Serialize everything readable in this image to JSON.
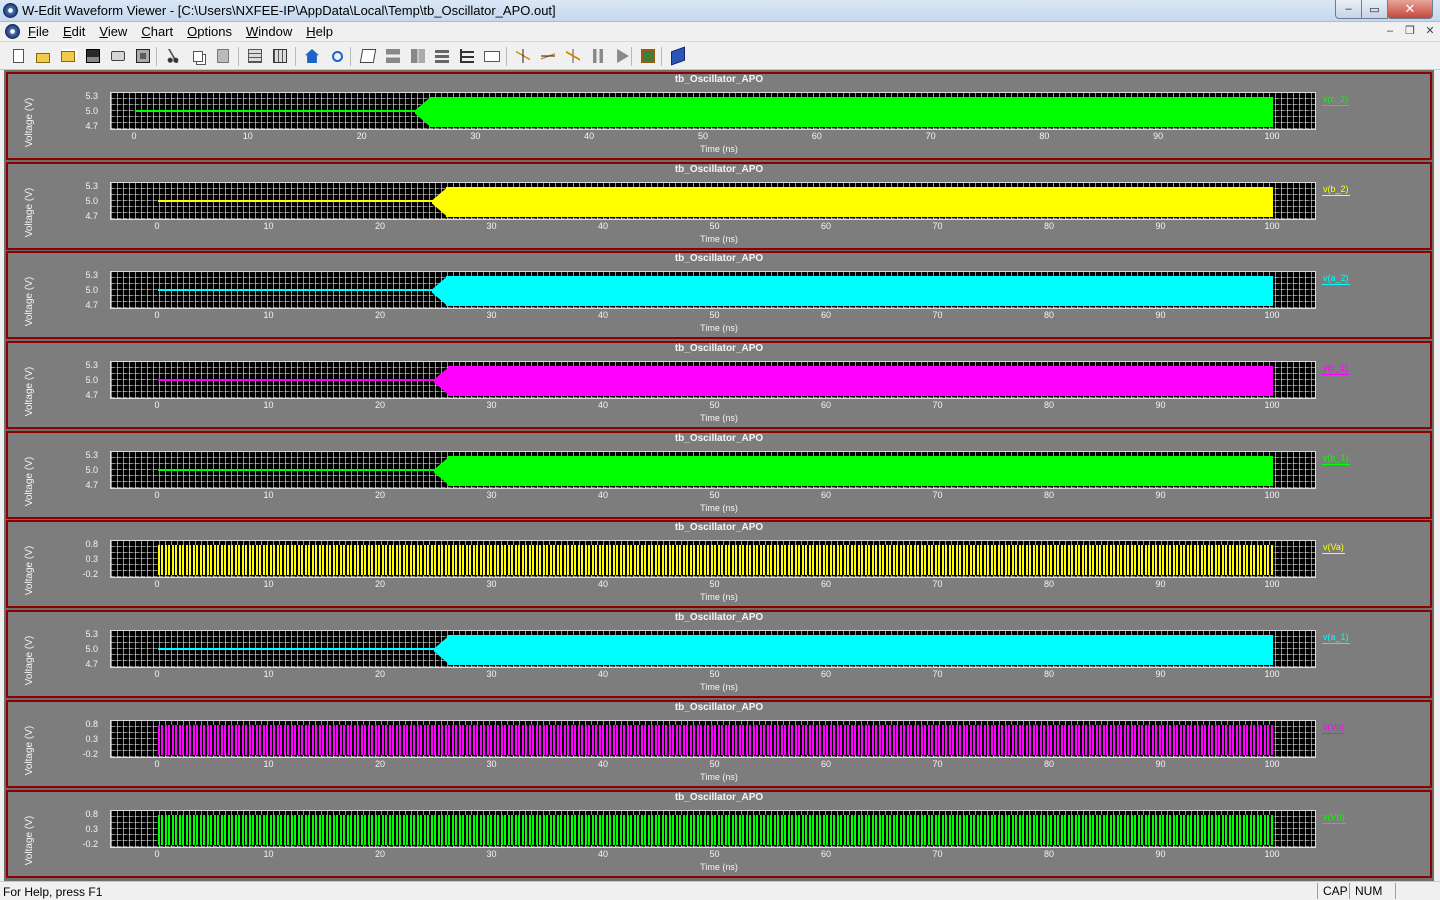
{
  "window": {
    "title": "W-Edit Waveform Viewer - [C:\\Users\\NXFEE-IP\\AppData\\Local\\Temp\\tb_Oscillator_APO.out]",
    "controls": {
      "minimize": "–",
      "maximize": "▭",
      "close": "✕"
    }
  },
  "menu": {
    "items": [
      {
        "ul": "F",
        "rest": "ile"
      },
      {
        "ul": "E",
        "rest": "dit"
      },
      {
        "ul": "V",
        "rest": "iew"
      },
      {
        "ul": "C",
        "rest": "hart"
      },
      {
        "ul": "O",
        "rest": "ptions"
      },
      {
        "ul": "W",
        "rest": "indow"
      },
      {
        "ul": "H",
        "rest": "elp"
      }
    ],
    "mdi": {
      "minimize": "–",
      "restore": "❐",
      "close": "✕"
    }
  },
  "toolbar": {
    "icons": [
      "new-icon",
      "open-icon",
      "open-folder-icon",
      "save-icon",
      "print-icon",
      "export-image-icon",
      "cut-icon",
      "copy-icon",
      "paste-icon",
      "tile-horizontal-icon",
      "tile-vertical-icon",
      "home-icon",
      "zoom-icon",
      "edit-chart-icon",
      "stack-icon",
      "stack-alt-icon",
      "arrange-icon",
      "fit-icon",
      "text-label-icon",
      "vertical-cursor-icon",
      "horizontal-cursor-icon",
      "xy-cursor-icon",
      "pause-icon",
      "play-icon",
      "chart-image-icon",
      "help-book-icon"
    ]
  },
  "charts": {
    "x_axis_label": "Time (ns)",
    "y_axis_label": "Voltage (V)",
    "x_ticks": [
      "0",
      "10",
      "20",
      "30",
      "40",
      "50",
      "60",
      "70",
      "80",
      "90",
      "100"
    ],
    "panels": [
      {
        "title": "tb_Oscillator_APO",
        "legend": "v(c_2)",
        "color": "#00ff00",
        "kind": "onset",
        "onset_ns": 25.8,
        "yticks": [
          "5.3",
          "5.0",
          "4.7"
        ],
        "x_start": 0,
        "x_end": 100,
        "x_max": 100
      },
      {
        "title": "tb_Oscillator_APO",
        "legend": "v(b_2)",
        "color": "#ffff00",
        "kind": "onset",
        "onset_ns": 25.8,
        "yticks": [
          "5.3",
          "5.0",
          "4.7"
        ],
        "x_start": 0,
        "x_end": 100,
        "x_max": 100
      },
      {
        "title": "tb_Oscillator_APO",
        "legend": "v(a_2)",
        "color": "#00ffff",
        "kind": "onset",
        "onset_ns": 25.8,
        "yticks": [
          "5.3",
          "5.0",
          "4.7"
        ],
        "x_start": 0,
        "x_end": 100,
        "x_max": 100
      },
      {
        "title": "tb_Oscillator_APO",
        "legend": "v(c_1)",
        "color": "#ff00ff",
        "kind": "onset",
        "onset_ns": 26.0,
        "yticks": [
          "5.3",
          "5.0",
          "4.7"
        ],
        "x_start": 0,
        "x_end": 100,
        "x_max": 100
      },
      {
        "title": "tb_Oscillator_APO",
        "legend": "v(b_1)",
        "color": "#00ff00",
        "kind": "onset",
        "onset_ns": 26.0,
        "yticks": [
          "5.3",
          "5.0",
          "4.7"
        ],
        "x_start": 0,
        "x_end": 100,
        "x_max": 100
      },
      {
        "title": "tb_Oscillator_APO",
        "legend": "v(Va)",
        "color": "#ffff00",
        "kind": "periodic",
        "yticks": [
          "0.8",
          "0.3",
          "-0.2"
        ],
        "x_start": 0,
        "x_end": 100,
        "x_max": 100
      },
      {
        "title": "tb_Oscillator_APO",
        "legend": "v(a_1)",
        "color": "#00ffff",
        "kind": "onset",
        "onset_ns": 26.0,
        "yticks": [
          "5.3",
          "5.0",
          "4.7"
        ],
        "x_start": 0,
        "x_end": 100,
        "x_max": 100
      },
      {
        "title": "tb_Oscillator_APO",
        "legend": "v(Vc)",
        "color": "#ff00ff",
        "kind": "periodic",
        "yticks": [
          "0.8",
          "0.3",
          "-0.2"
        ],
        "x_start": 0,
        "x_end": 100,
        "x_max": 100
      },
      {
        "title": "tb_Oscillator_APO",
        "legend": "v(Vb)",
        "color": "#00ff00",
        "kind": "periodic",
        "yticks": [
          "0.8",
          "0.3",
          "-0.2"
        ],
        "x_start": 0,
        "x_end": 100,
        "x_max": 100
      }
    ]
  },
  "status": {
    "help": "For Help, press F1",
    "cap": "CAP",
    "num": "NUM"
  }
}
